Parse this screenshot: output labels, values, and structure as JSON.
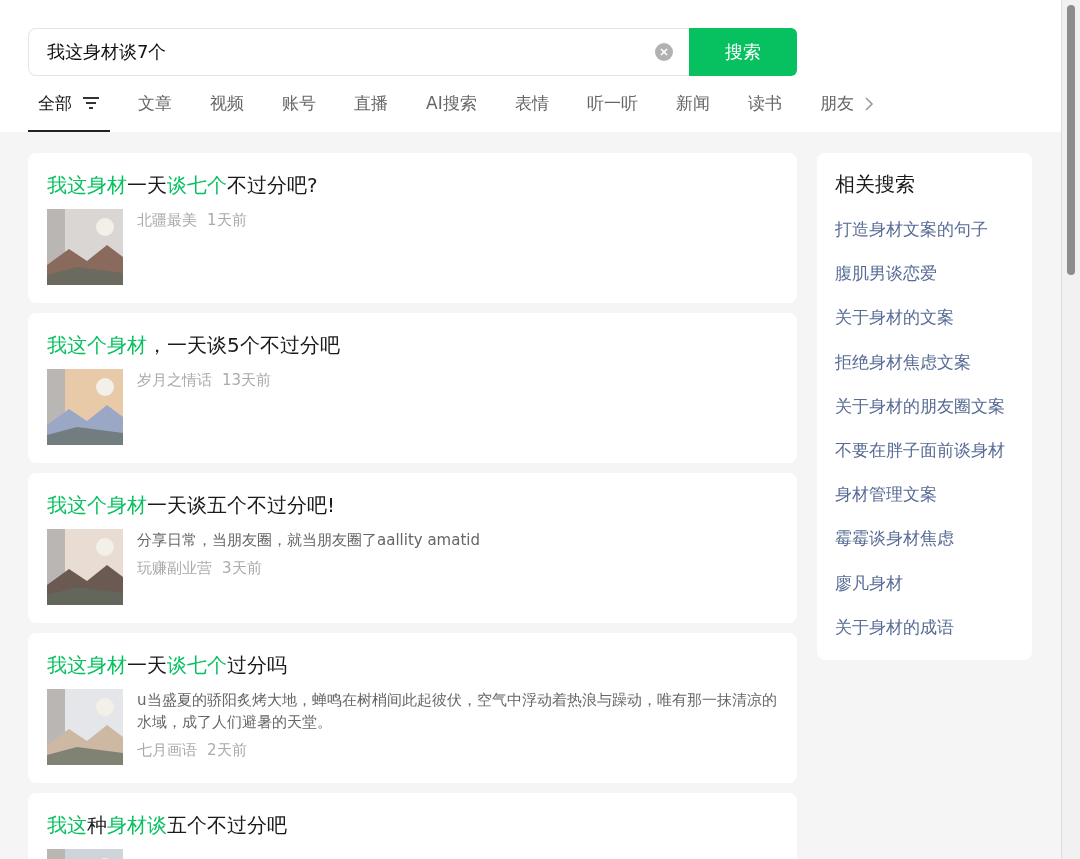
{
  "search": {
    "value": "我这身材谈7个",
    "button": "搜索"
  },
  "tabs": [
    {
      "label": "全部",
      "selected": true
    },
    {
      "label": "文章",
      "selected": false
    },
    {
      "label": "视频",
      "selected": false
    },
    {
      "label": "账号",
      "selected": false
    },
    {
      "label": "直播",
      "selected": false
    },
    {
      "label": "AI搜索",
      "selected": false
    },
    {
      "label": "表情",
      "selected": false
    },
    {
      "label": "听一听",
      "selected": false
    },
    {
      "label": "新闻",
      "selected": false
    },
    {
      "label": "读书",
      "selected": false
    },
    {
      "label": "朋友",
      "selected": false
    }
  ],
  "results": [
    {
      "title": [
        {
          "text": "我这身材",
          "highlight": true
        },
        {
          "text": "一天",
          "highlight": false
        },
        {
          "text": "谈七个",
          "highlight": true
        },
        {
          "text": "不过分吧?",
          "highlight": false
        }
      ],
      "thumbnail": {
        "kind": "picture"
      },
      "source": "北疆最美",
      "time": "1天前"
    },
    {
      "title": [
        {
          "text": "我这个身材",
          "highlight": true
        },
        {
          "text": "，一天谈5个不过分吧",
          "highlight": false
        }
      ],
      "thumbnail": {
        "kind": "picture"
      },
      "source": "岁月之情话",
      "time": "13天前"
    },
    {
      "title": [
        {
          "text": "我这个身材",
          "highlight": true
        },
        {
          "text": "一天谈五个不过分吧!",
          "highlight": false
        }
      ],
      "thumbnail": {
        "kind": "picture"
      },
      "summary": "分享日常，当朋友圈，就当朋友圈了aallity amatid",
      "source": "玩赚副业营",
      "time": "3天前"
    },
    {
      "title": [
        {
          "text": "我这身材",
          "highlight": true
        },
        {
          "text": "一天",
          "highlight": false
        },
        {
          "text": "谈七个",
          "highlight": true
        },
        {
          "text": "过分吗",
          "highlight": false
        }
      ],
      "thumbnail": {
        "kind": "picture"
      },
      "summary": "u当盛夏的骄阳炙烤大地，蝉鸣在树梢间此起彼伏，空气中浮动着热浪与躁动，唯有那一抹清凉的水域，成了人们避暑的天堂。",
      "source": "七月画语",
      "time": "2天前"
    },
    {
      "title": [
        {
          "text": "我这",
          "highlight": true
        },
        {
          "text": "种",
          "highlight": false
        },
        {
          "text": "身材谈",
          "highlight": true
        },
        {
          "text": "五个不过分吧",
          "highlight": false
        }
      ],
      "thumbnail": {
        "kind": "picture"
      }
    }
  ],
  "related": {
    "title": "相关搜索",
    "items": [
      "打造身材文案的句子",
      "腹肌男谈恋爱",
      "关于身材的文案",
      "拒绝身材焦虑文案",
      "关于身材的朋友圈文案",
      "不要在胖子面前谈身材",
      "身材管理文案",
      "霉霉谈身材焦虑",
      "廖凡身材",
      "关于身材的成语"
    ]
  }
}
